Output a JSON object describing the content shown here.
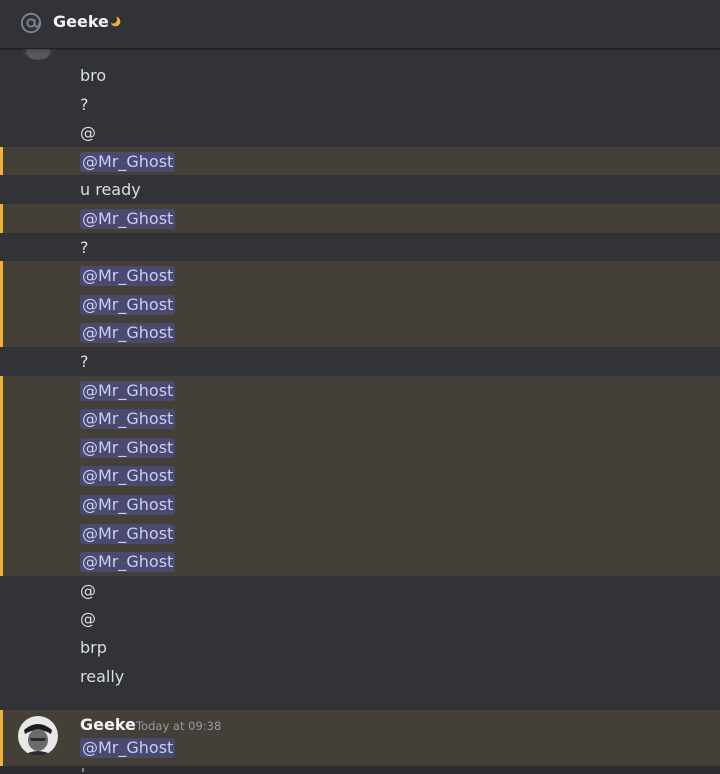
{
  "header": {
    "title": "Geeke",
    "status_icon": "moon-icon",
    "leading_icon": "at-sign-icon"
  },
  "colors": {
    "background": "#313338",
    "mention_highlight": "#f0b232",
    "mention_pill_text": "#c9cdfb",
    "text": "#dbdee1",
    "timestamp": "#949ba4"
  },
  "messages": [
    {
      "text": "bro",
      "mention": false
    },
    {
      "text": "?",
      "mention": false
    },
    {
      "text": "@",
      "mention": false
    },
    {
      "text": "@Mr_Ghost",
      "mention": true,
      "pill": true
    },
    {
      "text": "u ready",
      "mention": false
    },
    {
      "text": "@Mr_Ghost",
      "mention": true,
      "pill": true
    },
    {
      "text": "?",
      "mention": false
    },
    {
      "text": "@Mr_Ghost",
      "mention": true,
      "pill": true
    },
    {
      "text": "@Mr_Ghost",
      "mention": true,
      "pill": true
    },
    {
      "text": "@Mr_Ghost",
      "mention": true,
      "pill": true
    },
    {
      "text": "?",
      "mention": false
    },
    {
      "text": "@Mr_Ghost",
      "mention": true,
      "pill": true
    },
    {
      "text": "@Mr_Ghost",
      "mention": true,
      "pill": true
    },
    {
      "text": "@Mr_Ghost",
      "mention": true,
      "pill": true
    },
    {
      "text": "@Mr_Ghost",
      "mention": true,
      "pill": true
    },
    {
      "text": "@Mr_Ghost",
      "mention": true,
      "pill": true
    },
    {
      "text": "@Mr_Ghost",
      "mention": true,
      "pill": true
    },
    {
      "text": "@Mr_Ghost",
      "mention": true,
      "pill": true
    },
    {
      "text": "@",
      "mention": false
    },
    {
      "text": "@",
      "mention": false
    },
    {
      "text": "brp",
      "mention": false
    },
    {
      "text": "really",
      "mention": false
    }
  ],
  "last_group": {
    "author": "Geeke",
    "timestamp": "Today at 09:38",
    "text": "@Mr_Ghost"
  }
}
